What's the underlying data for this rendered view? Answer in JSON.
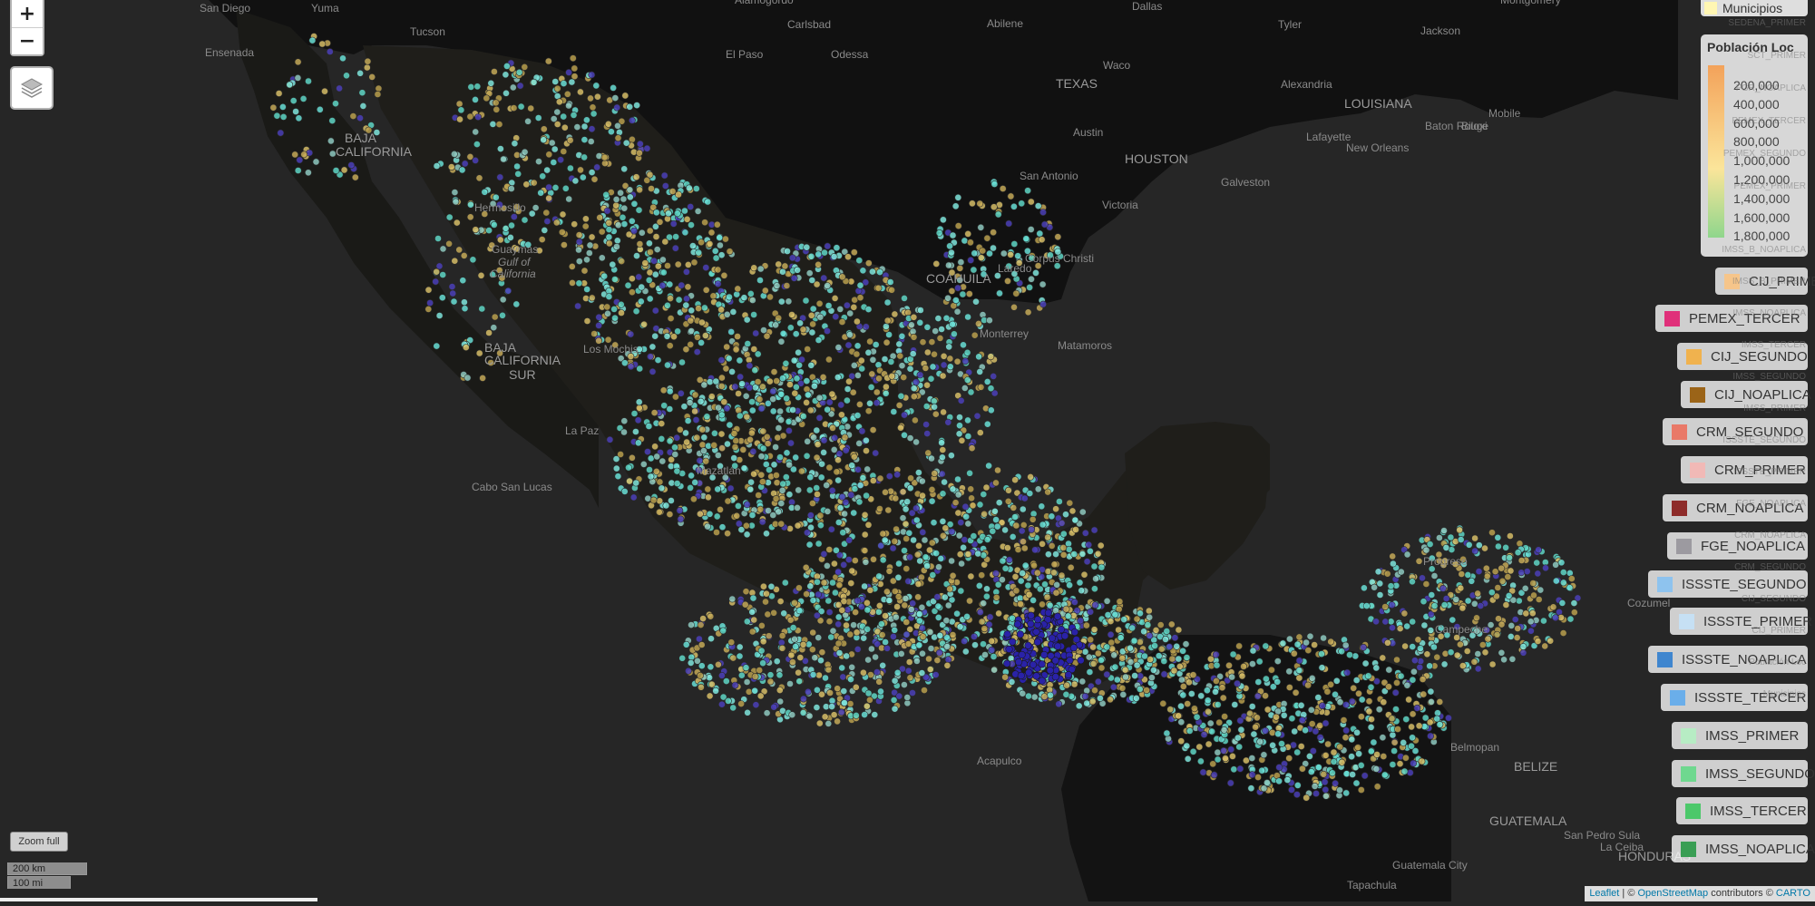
{
  "map": {
    "places": [
      {
        "name": "San Diego",
        "kind": "city"
      },
      {
        "name": "Yuma",
        "kind": "city"
      },
      {
        "name": "Ensenada",
        "kind": "city"
      },
      {
        "name": "Tucson",
        "kind": "city"
      },
      {
        "name": "Alamogordo",
        "kind": "city"
      },
      {
        "name": "Carlsbad",
        "kind": "city"
      },
      {
        "name": "Abilene",
        "kind": "city"
      },
      {
        "name": "Dallas",
        "kind": "city"
      },
      {
        "name": "Tyler",
        "kind": "city"
      },
      {
        "name": "Jackson",
        "kind": "city"
      },
      {
        "name": "Montgomery",
        "kind": "city"
      },
      {
        "name": "El Paso",
        "kind": "city"
      },
      {
        "name": "Odessa",
        "kind": "city"
      },
      {
        "name": "TEXAS",
        "kind": "state"
      },
      {
        "name": "Waco",
        "kind": "city"
      },
      {
        "name": "Alexandria",
        "kind": "city"
      },
      {
        "name": "LOUISIANA",
        "kind": "state"
      },
      {
        "name": "Baton Rouge",
        "kind": "city"
      },
      {
        "name": "Biloxi",
        "kind": "city"
      },
      {
        "name": "Mobile",
        "kind": "city"
      },
      {
        "name": "Lafayette",
        "kind": "city"
      },
      {
        "name": "New Orleans",
        "kind": "city"
      },
      {
        "name": "Austin",
        "kind": "city"
      },
      {
        "name": "HOUSTON",
        "kind": "capital"
      },
      {
        "name": "San Antonio",
        "kind": "city"
      },
      {
        "name": "Galveston",
        "kind": "city"
      },
      {
        "name": "Victoria",
        "kind": "city"
      },
      {
        "name": "Corpus Christi",
        "kind": "city"
      },
      {
        "name": "Laredo",
        "kind": "city"
      },
      {
        "name": "BAJA",
        "kind": "state"
      },
      {
        "name": "CALIFORNIA",
        "kind": "state"
      },
      {
        "name": "Hermosillo",
        "kind": "city"
      },
      {
        "name": "Guaymas",
        "kind": "city"
      },
      {
        "name": "Gulf of",
        "kind": "water"
      },
      {
        "name": "California",
        "kind": "water"
      },
      {
        "name": "COAHUILA",
        "kind": "state"
      },
      {
        "name": "Monterrey",
        "kind": "city"
      },
      {
        "name": "Matamoros",
        "kind": "city"
      },
      {
        "name": "Los Mochis",
        "kind": "city"
      },
      {
        "name": "BAJA",
        "kind": "state"
      },
      {
        "name": "CALIFORNIA",
        "kind": "state"
      },
      {
        "name": "SUR",
        "kind": "state"
      },
      {
        "name": "La Paz",
        "kind": "city"
      },
      {
        "name": "Cabo San Lucas",
        "kind": "city"
      },
      {
        "name": "Mazatlán",
        "kind": "city"
      },
      {
        "name": "Progreso",
        "kind": "city"
      },
      {
        "name": "Cozumel",
        "kind": "city"
      },
      {
        "name": "Campeche",
        "kind": "city"
      },
      {
        "name": "Acapulco",
        "kind": "city"
      },
      {
        "name": "Belmopan",
        "kind": "city"
      },
      {
        "name": "BELIZE",
        "kind": "state"
      },
      {
        "name": "GUATEMALA",
        "kind": "state"
      },
      {
        "name": "San Pedro Sula",
        "kind": "city"
      },
      {
        "name": "La Ceiba",
        "kind": "city"
      },
      {
        "name": "HONDURAS",
        "kind": "state"
      },
      {
        "name": "Tapachula",
        "kind": "city"
      },
      {
        "name": "Guatemala City",
        "kind": "city"
      }
    ]
  },
  "controls": {
    "zoom_in": "+",
    "zoom_out": "−",
    "zoom_full": "Zoom full",
    "scale_km": "200 km",
    "scale_mi": "100 mi"
  },
  "legends": {
    "municipios": {
      "label": "Municipios",
      "color": "#fff6b3"
    },
    "poblacion": {
      "title": "Población Loc",
      "ticks": [
        "200,000",
        "400,000",
        "600,000",
        "800,000",
        "1,000,000",
        "1,200,000",
        "1,400,000",
        "1,600,000",
        "1,800,000"
      ]
    },
    "layers": [
      {
        "label": "CIJ_PRIMER",
        "color": "#f6c58a"
      },
      {
        "label": "PEMEX_TERCER",
        "color": "#e0307a"
      },
      {
        "label": "CIJ_SEGUNDO",
        "color": "#f0b24e"
      },
      {
        "label": "CIJ_NOAPLICA",
        "color": "#9b6418"
      },
      {
        "label": "CRM_SEGUNDO",
        "color": "#e97968"
      },
      {
        "label": "CRM_PRIMER",
        "color": "#f1b9b6"
      },
      {
        "label": "CRM_NOAPLICA",
        "color": "#8e2c2a"
      },
      {
        "label": "FGE_NOAPLICA",
        "color": "#9c9aa0"
      },
      {
        "label": "ISSSTE_SEGUNDO",
        "color": "#8ec3ee"
      },
      {
        "label": "ISSSTE_PRIMER",
        "color": "#c6e0f4"
      },
      {
        "label": "ISSSTE_NOAPLICA",
        "color": "#3f86cf"
      },
      {
        "label": "ISSSTE_TERCER",
        "color": "#6aaeea"
      },
      {
        "label": "IMSS_PRIMER",
        "color": "#b7ecc4"
      },
      {
        "label": "IMSS_SEGUNDO",
        "color": "#6fd88f"
      },
      {
        "label": "IMSS_TERCER",
        "color": "#4cc86a"
      },
      {
        "label": "IMSS_NOAPLICA",
        "color": "#3a9e54"
      }
    ],
    "ghost_labels": [
      "SEDENA_PRIMER",
      "SCT_PRIMER",
      "FGR_NOAPLICA",
      "PEMEX_TERCER",
      "PEMEX_SEGUNDO",
      "PEMEX_PRIMER",
      "IMSS_B_NOAPLICA",
      "IMSS_B_PRIMER",
      "IMSS_NOAPLICA",
      "IMSS_TERCER",
      "IMSS_SEGUNDO",
      "IMSS_PRIMER",
      "ISSSTE_SEGUNDO",
      "ISSSTE_PRIMER",
      "FGE_NOAPLICA",
      "CRM_NOAPLICA",
      "CRM_SEGUNDO",
      "CIJ_SEGUNDO",
      "CIJ_PRIMER",
      "Población Loc",
      "Municipios"
    ]
  },
  "attribution": {
    "leaflet": "Leaflet",
    "sep": " | © ",
    "osm": "OpenStreetMap",
    "contrib": " contributors © ",
    "carto": "CARTO"
  }
}
